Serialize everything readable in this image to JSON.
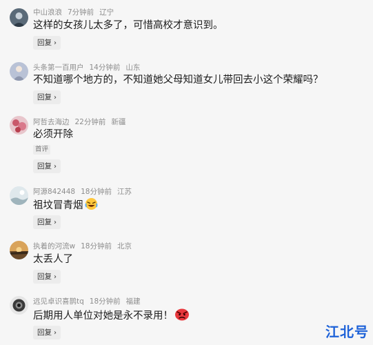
{
  "comments": [
    {
      "username": "中山浪浪",
      "time": "7分钟前",
      "location": "辽宁",
      "text": "这样的女孩儿太多了，可惜高校才意识到。",
      "reply_label": "回复"
    },
    {
      "username": "头条第一百用户",
      "time": "14分钟前",
      "location": "山东",
      "text": "不知道哪个地方的，不知道她父母知道女儿带回去小这个荣耀吗？",
      "reply_label": "回复"
    },
    {
      "username": "阿哲去海边",
      "time": "22分钟前",
      "location": "新疆",
      "text": "必须开除",
      "badge": "首评",
      "reply_label": "回复"
    },
    {
      "username": "阿源842448",
      "time": "18分钟前",
      "location": "江苏",
      "text": "祖坟冒青烟",
      "emoji": "laughing-crying-emoji",
      "reply_label": "回复"
    },
    {
      "username": "执着的河流w",
      "time": "18分钟前",
      "location": "北京",
      "text": "太丢人了",
      "reply_label": "回复"
    },
    {
      "username": "远见卓识喜鹊tq",
      "time": "18分钟前",
      "location": "福建",
      "text": "后期用人单位对她是永不录用！",
      "emoji": "angry-face-emoji",
      "reply_label": "回复"
    }
  ],
  "watermark": "江北号",
  "colors": {
    "background": "#f6f6f6",
    "meta_text": "#8d8d8d",
    "body_text": "#1b1b1b",
    "reply_bg": "#ececec",
    "watermark": "#1e62d8"
  }
}
